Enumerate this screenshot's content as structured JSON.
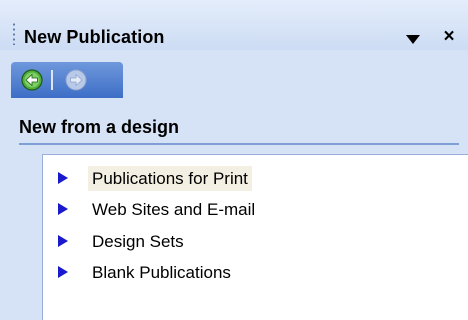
{
  "pane": {
    "title": "New Publication",
    "dropdown_icon": "triangle-down-icon",
    "close_label": "×"
  },
  "nav": {
    "back_icon": "back-arrow-icon",
    "forward_icon": "forward-arrow-icon",
    "back_enabled": true,
    "forward_enabled": false
  },
  "section": {
    "heading": "New from a design"
  },
  "list": {
    "bullet_icon": "triangle-right-icon",
    "bullet_color": "#1a1acc",
    "selected_index": 0,
    "items": [
      {
        "label": "Publications for Print"
      },
      {
        "label": "Web Sites and E-mail"
      },
      {
        "label": "Design Sets"
      },
      {
        "label": "Blank Publications"
      }
    ]
  },
  "colors": {
    "pane_background": "#d6e2f6",
    "nav_bar": "#4a7acc",
    "selected_background": "#f3efe2"
  }
}
